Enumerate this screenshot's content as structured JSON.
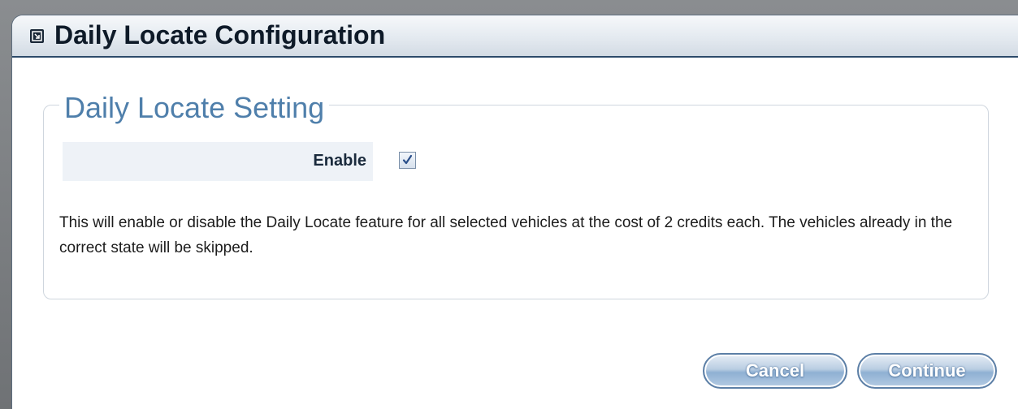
{
  "dialog": {
    "title": "Daily Locate Configuration",
    "icon": "collapse-icon"
  },
  "section": {
    "legend": "Daily Locate Setting",
    "enable_label": "Enable",
    "enable_checked": true,
    "description": "This will enable or disable the Daily Locate feature for all selected vehicles at the cost of 2 credits each. The vehicles already in the correct state will be skipped."
  },
  "buttons": {
    "cancel_label": "Cancel",
    "continue_label": "Continue"
  },
  "colors": {
    "title_border": "#2c4a6a",
    "legend_text": "#4f7fab",
    "button_border": "#5c7fa6"
  }
}
